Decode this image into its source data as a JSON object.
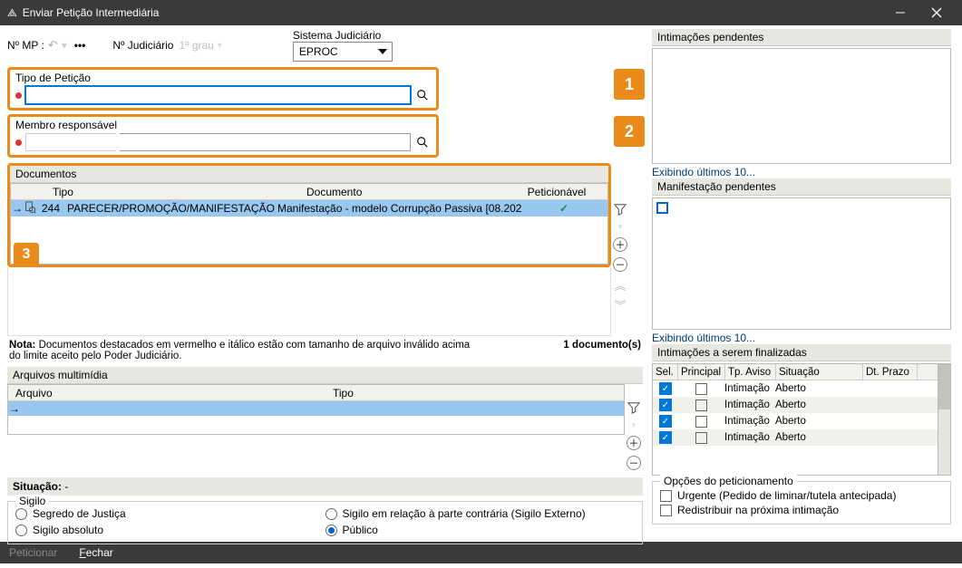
{
  "window": {
    "title": "Enviar Petição Intermediária"
  },
  "top": {
    "nmp": "Nº MP :",
    "njud": "Nº Judiciário",
    "grau": "1º grau",
    "sistema_label": "Sistema Judiciário",
    "sistema_value": "EPROC"
  },
  "field_tipo": {
    "label": "Tipo de Petição",
    "value": "",
    "tag": "1"
  },
  "field_membro": {
    "label": "Membro responsável",
    "value": "",
    "tag": "2"
  },
  "documentos": {
    "title": "Documentos",
    "tag": "3",
    "headers": {
      "tipo": "Tipo",
      "documento": "Documento",
      "peticionavel": "Peticionável"
    },
    "row": {
      "num": "244",
      "tipo": "PARECER/PROMOÇÃO/MANIFESTAÇÃO MINIST",
      "documento": "Manifestação - modelo Corrupção Passiva [08.202"
    },
    "note_bold": "Nota:",
    "note_text": "Documentos destacados em vermelho e itálico estão com tamanho de arquivo inválido acima do limite aceito pelo Poder Judiciário.",
    "count": "1 documento(s)"
  },
  "arquivos": {
    "title": "Arquivos multimídia",
    "headers": {
      "arquivo": "Arquivo",
      "tipo": "Tipo"
    }
  },
  "situacao": {
    "label": "Situação:",
    "value": "-"
  },
  "sigilo": {
    "legend": "Sigilo",
    "opts": {
      "segredo": "Segredo de Justiça",
      "absoluto": "Sigilo absoluto",
      "externo": "Sigilo em relação à parte contrária (Sigilo Externo)",
      "publico": "Público"
    }
  },
  "right": {
    "intim_title": "Intimações pendentes",
    "exib": "Exibindo últimos 10...",
    "manif_title": "Manifestação pendentes",
    "final_title": "Intimações a serem finalizadas",
    "final_headers": {
      "sel": "Sel.",
      "principal": "Principal",
      "tp": "Tp. Aviso",
      "sit": "Situação",
      "dt": "Dt. Prazo"
    },
    "final_rows": [
      {
        "tp": "Intimação",
        "sit": "Aberto"
      },
      {
        "tp": "Intimação",
        "sit": "Aberto"
      },
      {
        "tp": "Intimação",
        "sit": "Aberto"
      },
      {
        "tp": "Intimação",
        "sit": "Aberto"
      }
    ]
  },
  "opcoes": {
    "legend": "Opções do peticionamento",
    "urgente": "Urgente (Pedido de liminar/tutela antecipada)",
    "redist": "Redistribuir na próxima intimação"
  },
  "footer": {
    "peticionar": "Peticionar",
    "fechar_pre": "F",
    "fechar_rest": "echar"
  }
}
